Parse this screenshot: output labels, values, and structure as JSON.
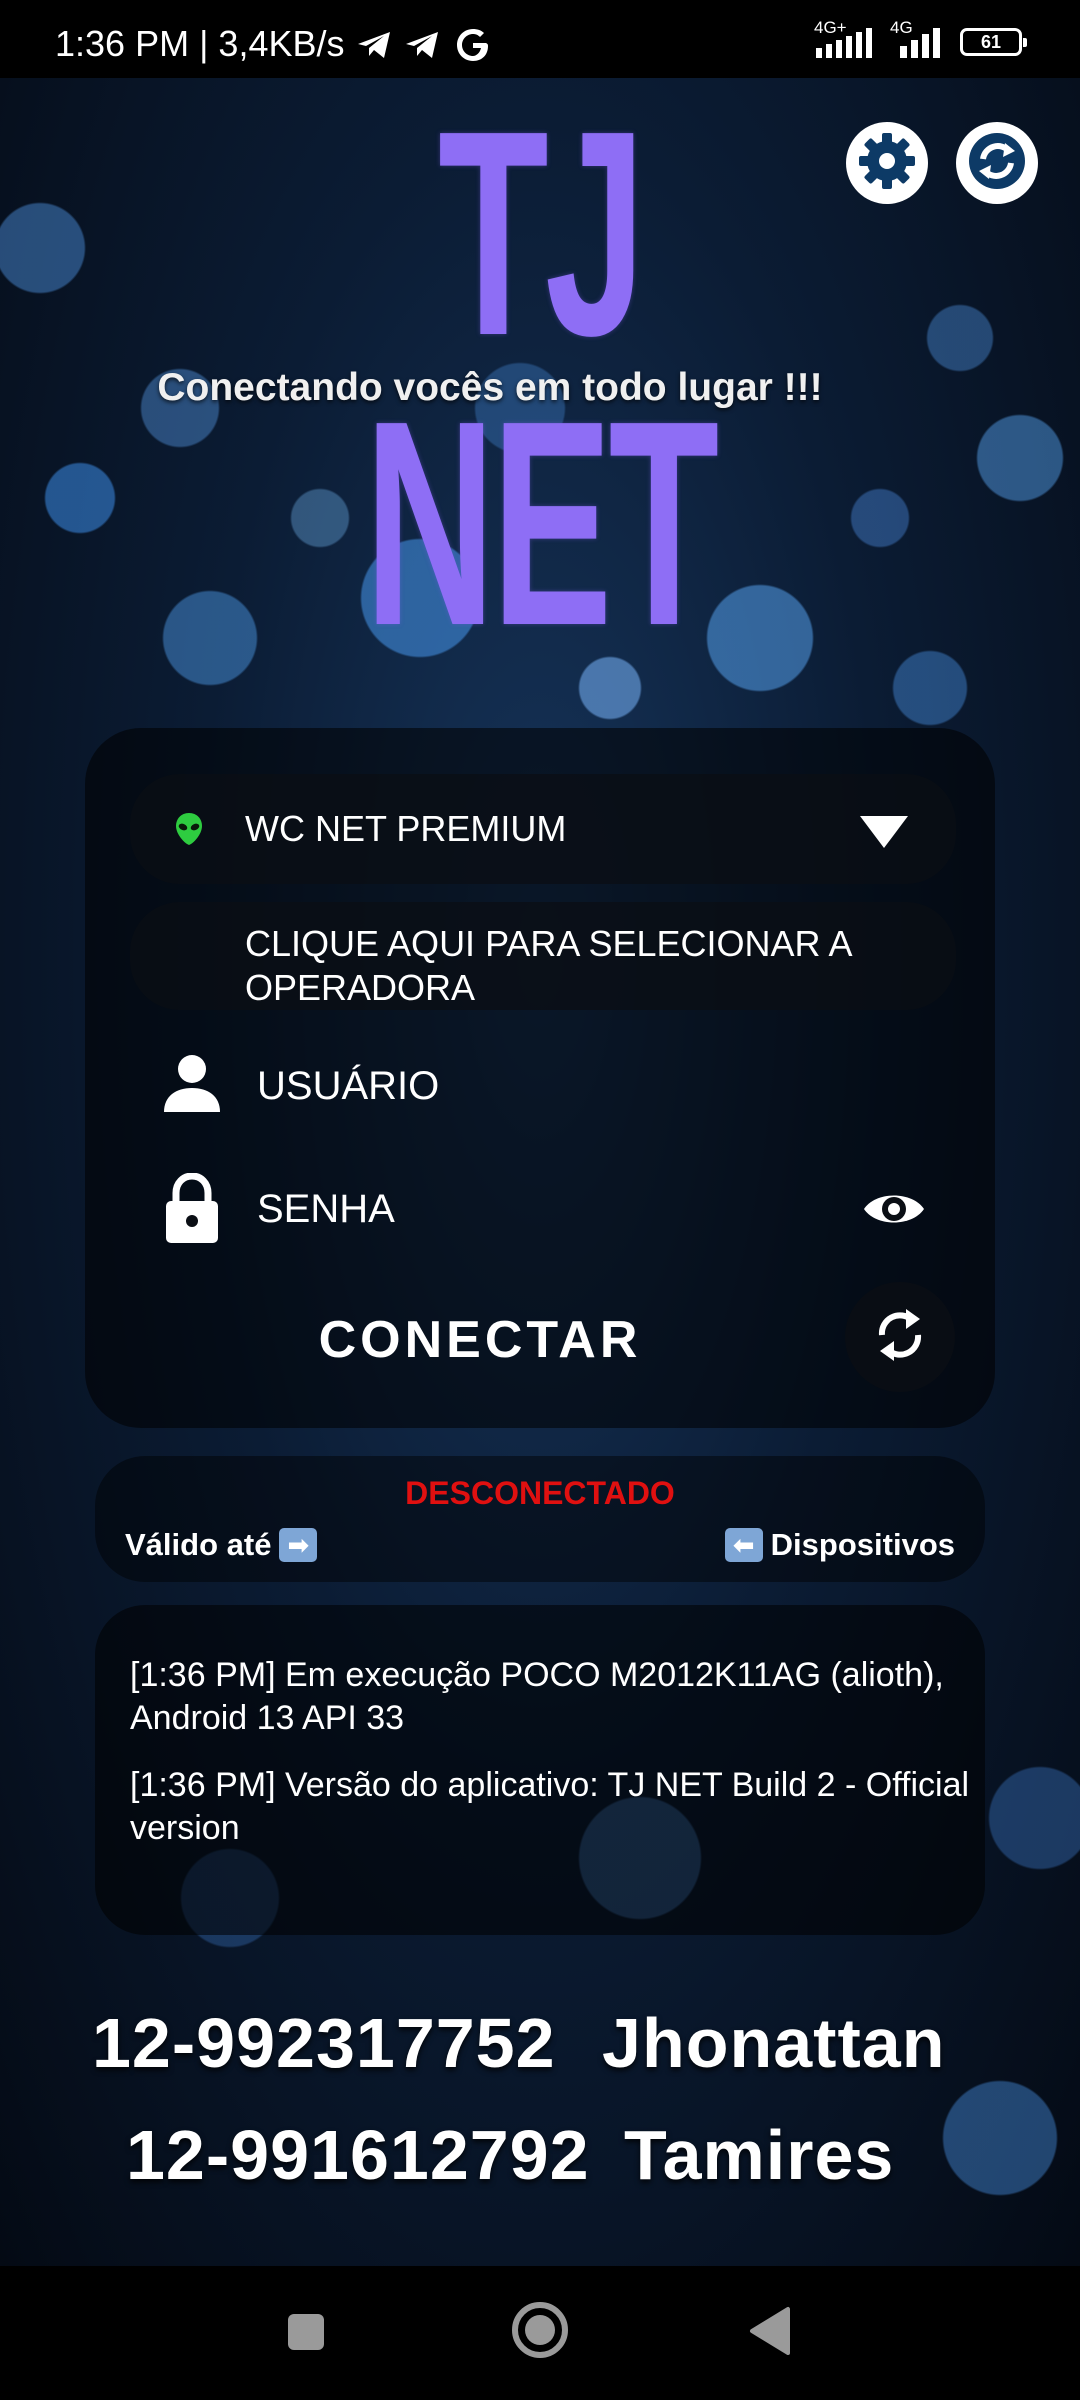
{
  "status_bar": {
    "time": "1:36 PM | 3,4KB/s",
    "network_1": "4G+",
    "network_2": "4G",
    "battery": "61"
  },
  "header": {
    "logo_text": "TJ NET",
    "slogan": "Conectando vocês em todo lugar !!!",
    "logo_color": "#8e6ef5"
  },
  "form": {
    "server_name": "WC NET PREMIUM",
    "operator_prompt": "CLIQUE AQUI PARA SELECIONAR A OPERADORA",
    "username_placeholder": "USUÁRIO",
    "password_placeholder": "SENHA",
    "connect_label": "CONECTAR"
  },
  "status": {
    "connection": "DESCONECTADO",
    "connection_color": "#e01010",
    "valid_until_label": "Válido até",
    "devices_label": "Dispositivos"
  },
  "log": [
    "[1:36 PM] Em execução POCO M2012K11AG (alioth), Android 13 API 33",
    "[1:36 PM] Versão do aplicativo: TJ NET Build 2 - Official version"
  ],
  "contacts": [
    {
      "phone": "12-992317752",
      "name": "Jhonattan"
    },
    {
      "phone": "12-991612792",
      "name": "Tamires"
    }
  ],
  "icons": {
    "settings": "gear-icon",
    "refresh": "refresh-icon",
    "server": "alien-icon",
    "dropdown": "triangle-down-icon",
    "user": "person-icon",
    "password": "lock-icon",
    "show_password": "eye-icon",
    "reconnect": "sync-icon"
  }
}
